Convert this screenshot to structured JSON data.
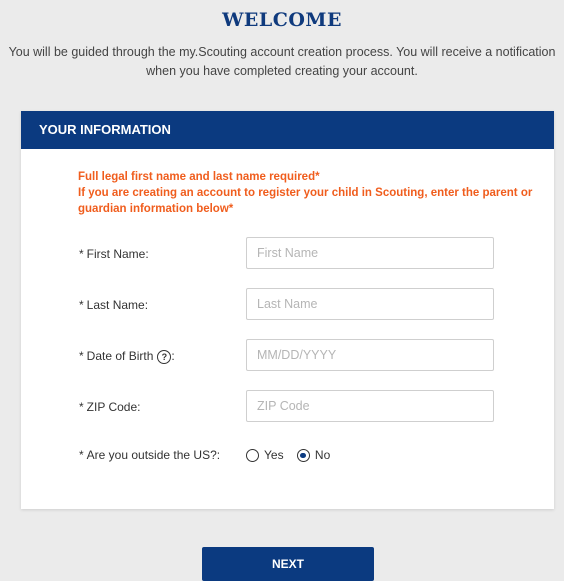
{
  "page": {
    "title": "WELCOME",
    "intro": "You will be guided through the my.Scouting account creation process. You will receive a notification when you have completed creating your account."
  },
  "card": {
    "header": "YOUR INFORMATION",
    "notice_line1": "Full legal first name and last name required*",
    "notice_line2": "If you are creating an account to register your child in Scouting, enter the parent or guardian information below*"
  },
  "form": {
    "required_mark": "*",
    "first_name": {
      "label": "First Name",
      "placeholder": "First Name",
      "value": ""
    },
    "last_name": {
      "label": "Last Name",
      "placeholder": "Last Name",
      "value": ""
    },
    "dob": {
      "label": "Date of Birth",
      "placeholder": "MM/DD/YYYY",
      "value": "",
      "help_icon": "question-circle-icon",
      "help_glyph": "?"
    },
    "zip": {
      "label": "ZIP Code",
      "placeholder": "ZIP Code",
      "value": ""
    },
    "outside_us": {
      "label": "Are you outside the US?",
      "options": [
        "Yes",
        "No"
      ],
      "selected": "No"
    },
    "colon": ":"
  },
  "actions": {
    "next_label": "NEXT"
  },
  "colors": {
    "brand_blue": "#0b3a80",
    "notice_orange": "#f05d1d",
    "title_blue": "#0f3a7d"
  }
}
